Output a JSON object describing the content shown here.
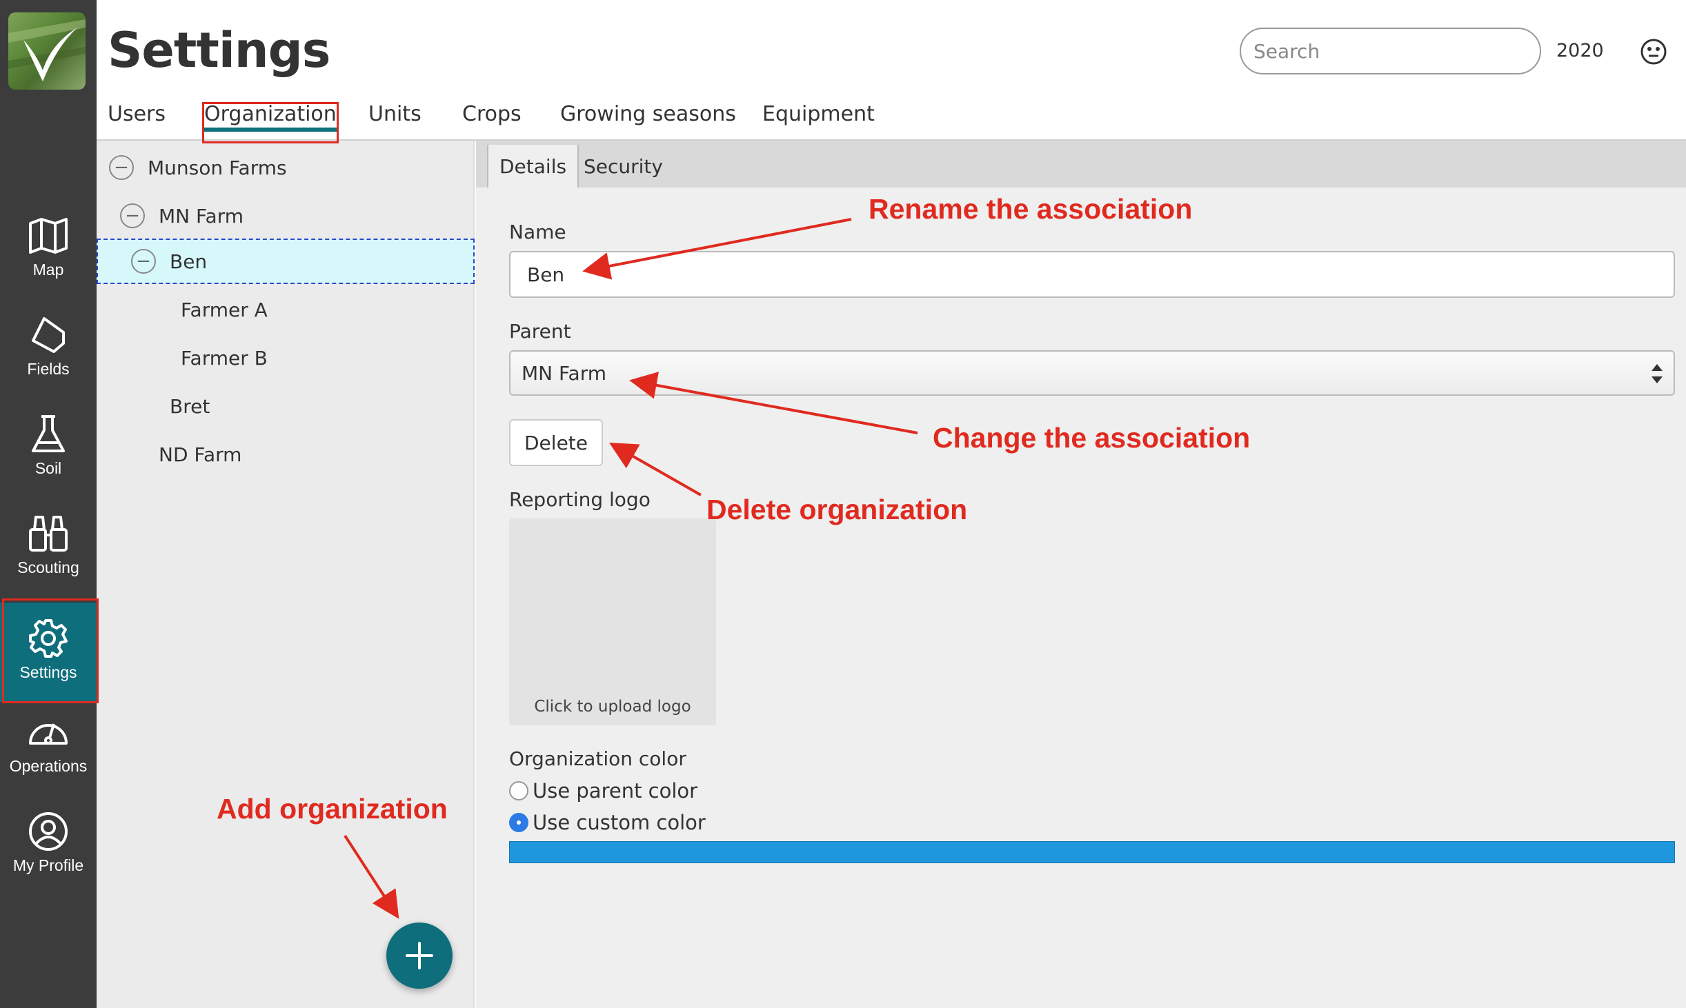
{
  "header": {
    "title": "Settings",
    "search_placeholder": "Search",
    "year": "2020"
  },
  "sidebar": {
    "items": [
      {
        "label": "Map",
        "icon": "map-icon"
      },
      {
        "label": "Fields",
        "icon": "field-icon"
      },
      {
        "label": "Soil",
        "icon": "flask-icon"
      },
      {
        "label": "Scouting",
        "icon": "binoculars-icon"
      },
      {
        "label": "Settings",
        "icon": "gear-icon",
        "active": true
      },
      {
        "label": "Operations",
        "icon": "gauge-icon"
      },
      {
        "label": "My Profile",
        "icon": "user-icon"
      }
    ]
  },
  "tabs": [
    "Users",
    "Organization",
    "Units",
    "Crops",
    "Growing seasons",
    "Equipment"
  ],
  "active_tab": "Organization",
  "tree": {
    "items": [
      "Munson Farms",
      "MN Farm",
      "Ben",
      "Farmer A",
      "Farmer B",
      "Bret",
      "ND Farm"
    ],
    "selected": "Ben"
  },
  "details": {
    "tabs": [
      "Details",
      "Security"
    ],
    "name_label": "Name",
    "name_value": "Ben",
    "parent_label": "Parent",
    "parent_value": "MN Farm",
    "delete_label": "Delete",
    "logo_label": "Reporting logo",
    "upload_text": "Click to upload logo",
    "color_label": "Organization color",
    "radio_parent": "Use parent color",
    "radio_custom": "Use custom color",
    "custom_color": "#1e97dd"
  },
  "annotations": {
    "rename": "Rename the association",
    "change": "Change the association",
    "delete": "Delete organization",
    "add": "Add organization"
  },
  "colors": {
    "accent": "#0e6e7c",
    "sidebar": "#3c3c3c",
    "annotation": "#e02a1f"
  }
}
